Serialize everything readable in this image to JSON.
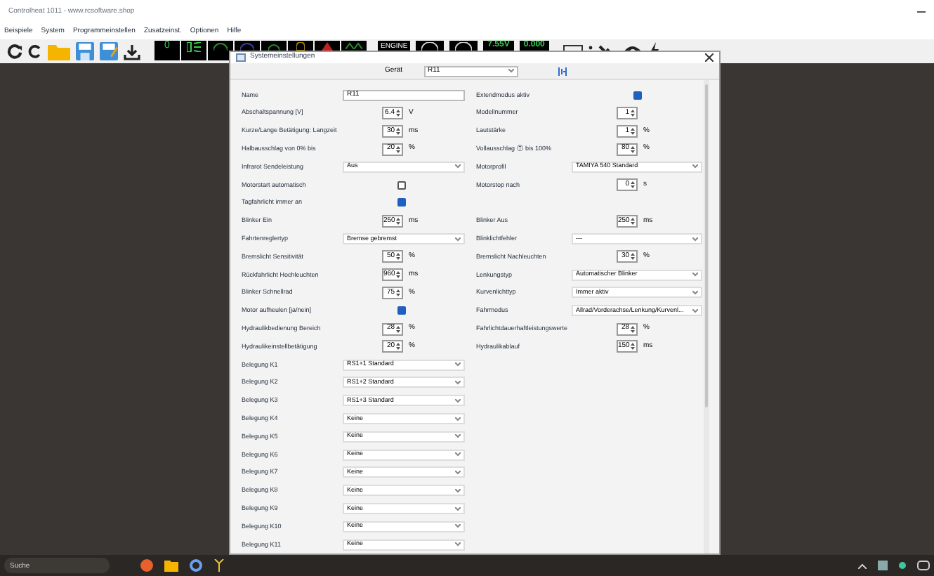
{
  "window": {
    "title": "Controlheat 1011 - www.rcsoftware.shop",
    "menu": [
      "Beispiele",
      "System",
      "Programmeinstellen",
      "Zusatzeinst.",
      "Optionen",
      "Hilfe"
    ]
  },
  "toolbar_displays": [
    "0",
    "ENGINE",
    "7.55V",
    "0.000"
  ],
  "dialog": {
    "title": "Systemeinstellungen",
    "device_label": "Gerät",
    "device_value": "R11",
    "left_rows": [
      {
        "kind": "text",
        "label": "Name",
        "value": "R11"
      },
      {
        "kind": "spin",
        "label": "Abschaltspannung [V]",
        "value": "6.4",
        "unit": "V"
      },
      {
        "kind": "spin",
        "label": "Kurze/Lange Betätigung: Langzeit",
        "value": "30",
        "unit": "ms"
      },
      {
        "kind": "spin",
        "label": "Halbausschlag von 0% bis",
        "value": "20",
        "unit": "%"
      },
      {
        "kind": "select",
        "label": "Infrarot Sendeleistung",
        "value": "Aus"
      },
      {
        "kind": "check",
        "label": "Motorstart automatisch",
        "checked": false
      },
      {
        "kind": "check",
        "label": "Tagfahrlicht immer an",
        "checked": true
      },
      {
        "kind": "spin",
        "label": "Blinker Ein",
        "value": "250",
        "unit": "ms"
      },
      {
        "kind": "select",
        "label": "Fahrtenreglertyp",
        "value": "Bremse gebremst"
      },
      {
        "kind": "spin",
        "label": "Bremslicht Sensitivität",
        "value": "50",
        "unit": "%"
      },
      {
        "kind": "spin",
        "label": "Rückfahrlicht Hochleuchten",
        "value": "960",
        "unit": "ms"
      },
      {
        "kind": "spin",
        "label": "Blinker Schnellrad",
        "value": "75",
        "unit": "%"
      },
      {
        "kind": "check",
        "label": "Motor aufheulen [ja/nein]",
        "checked": true
      },
      {
        "kind": "spin",
        "label": "Hydraulikbedienung Bereich",
        "value": "28",
        "unit": "%"
      },
      {
        "kind": "spin",
        "label": "Hydraulikeinstellbetätigung",
        "value": "20",
        "unit": "%"
      },
      {
        "kind": "select",
        "label": "Belegung K1",
        "value": "RS1+1 Standard"
      },
      {
        "kind": "select",
        "label": "Belegung K2",
        "value": "RS1+2 Standard"
      },
      {
        "kind": "select",
        "label": "Belegung K3",
        "value": "RS1+3 Standard"
      },
      {
        "kind": "select",
        "label": "Belegung K4",
        "value": "Keine"
      },
      {
        "kind": "select",
        "label": "Belegung K5",
        "value": "Keine"
      },
      {
        "kind": "select",
        "label": "Belegung K6",
        "value": "Keine"
      },
      {
        "kind": "select",
        "label": "Belegung K7",
        "value": "Keine"
      },
      {
        "kind": "select",
        "label": "Belegung K8",
        "value": "Keine"
      },
      {
        "kind": "select",
        "label": "Belegung K9",
        "value": "Keine"
      },
      {
        "kind": "select",
        "label": "Belegung K10",
        "value": "Keine"
      },
      {
        "kind": "select",
        "label": "Belegung K11",
        "value": "Keine"
      }
    ],
    "right_rows": [
      {
        "kind": "check",
        "label": "Extendmodus aktiv",
        "checked": true
      },
      {
        "kind": "spin",
        "label": "Modellnummer",
        "value": "1"
      },
      {
        "kind": "spin",
        "label": "Lautstärke",
        "value": "1",
        "unit": "%"
      },
      {
        "kind": "spin",
        "label": "Vollausschlag Ⓣ bis 100%",
        "value": "80",
        "unit": "%"
      },
      {
        "kind": "select",
        "label": "Motorprofil",
        "value": "TAMIYA 540 Standard"
      },
      {
        "kind": "spin",
        "label": "Motorstop nach",
        "value": "0",
        "unit": "s"
      },
      {
        "kind": "spin",
        "label": "Blinker Aus",
        "value": "250",
        "unit": "ms",
        "gap_before": true
      },
      {
        "kind": "select",
        "label": "Blinklichtfehler",
        "value": "---"
      },
      {
        "kind": "spin",
        "label": "Bremslicht Nachleuchten",
        "value": "30",
        "unit": "%"
      },
      {
        "kind": "select",
        "label": "Lenkungstyp",
        "value": "Automatischer Blinker"
      },
      {
        "kind": "select",
        "label": "Kurvenlichttyp",
        "value": "Immer aktiv"
      },
      {
        "kind": "select",
        "label": "Fahrmodus",
        "value": "Allrad/Vorderachse/Lenkung/Kurvenl..."
      },
      {
        "kind": "spin",
        "label": "Fahrlichtdauerhaftleistungswerte",
        "value": "28",
        "unit": "%"
      },
      {
        "kind": "spin",
        "label": "Hydraulikablauf",
        "value": "150",
        "unit": "ms"
      }
    ]
  },
  "taskbar": {
    "search_placeholder": "Suche"
  }
}
